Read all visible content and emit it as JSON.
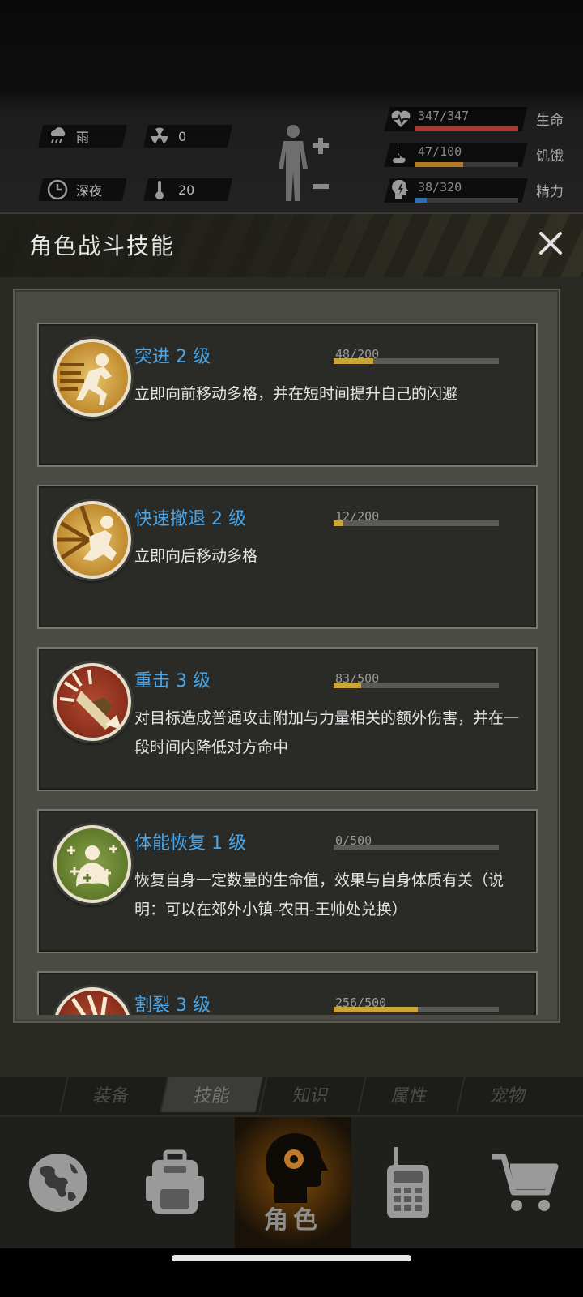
{
  "status": {
    "weather_label": "雨",
    "radiation_value": "0",
    "time_label": "深夜",
    "temperature_value": "20",
    "health": {
      "value": "347/347",
      "label": "生命",
      "fraction": 1.0,
      "color": "#a63a32"
    },
    "hunger": {
      "value": "47/100",
      "label": "饥饿",
      "fraction": 0.47,
      "color": "#b57a22"
    },
    "energy": {
      "value": "38/320",
      "label": "精力",
      "fraction": 0.12,
      "color": "#2f6fb0"
    }
  },
  "dialog": {
    "title": "角色战斗技能"
  },
  "skills": [
    {
      "name": "突进 2 级",
      "xp_text": "48/200",
      "xp_fraction": 0.24,
      "desc": "立即向前移动多格，并在短时间提升自己的闪避",
      "icon": "sprint-icon"
    },
    {
      "name": "快速撤退 2 级",
      "xp_text": "12/200",
      "xp_fraction": 0.06,
      "desc": "立即向后移动多格",
      "icon": "retreat-icon"
    },
    {
      "name": "重击 3 级",
      "xp_text": "83/500",
      "xp_fraction": 0.166,
      "desc": "对目标造成普通攻击附加与力量相关的额外伤害，并在一段时间内降低对方命中",
      "icon": "heavy-strike-icon"
    },
    {
      "name": "体能恢复 1 级",
      "xp_text": "0/500",
      "xp_fraction": 0.0,
      "desc": "恢复自身一定数量的生命值，效果与自身体质有关（说明：可以在郊外小镇-农田-王帅处兑换）",
      "icon": "recovery-icon"
    },
    {
      "name": "割裂 3 级",
      "xp_text": "256/500",
      "xp_fraction": 0.512,
      "desc": "",
      "icon": "rupture-icon"
    }
  ],
  "subtabs": [
    "装备",
    "技能",
    "知识",
    "属性",
    "宠物"
  ],
  "subtab_active": "技能",
  "nav": {
    "active_label": "角色"
  }
}
